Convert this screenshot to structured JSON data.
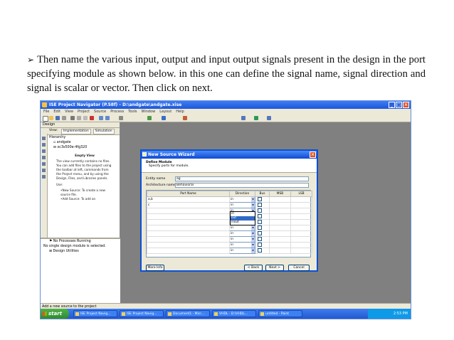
{
  "caption": {
    "bullet": "➢",
    "text": "Then name the various input, output and input output signals present in the design in the port specifying module as shown below. in this one can define the signal name, signal direction and signal is scalar or vector. Then click on next."
  },
  "window": {
    "title": "ISE Project Navigator (P.58f) - D:\\andgate\\andgate.xise",
    "menu": [
      "File",
      "Edit",
      "View",
      "Project",
      "Source",
      "Process",
      "Tools",
      "Window",
      "Layout",
      "Help"
    ]
  },
  "left_panel": {
    "header": "Design",
    "view_label": "View:",
    "tabs": [
      "Implementation",
      "Simulation"
    ],
    "hierarchy_label": "Hierarchy",
    "project": "andgate",
    "device": "xc3s500e-4fg320",
    "empty_view": {
      "title": "Empty View",
      "text": "The view currently contains no files. You can add files to the project using the toolbar at left, commands from the Project menu, and by using the Design, Files, and Libraries panels.",
      "use_label": "Use:",
      "items": [
        "•New Source: To create a new source file.",
        "•Add Source: To add an"
      ]
    },
    "processes": {
      "running": "No Processes Running",
      "message": "No single design module is selected.",
      "utilities": "Design Utilities"
    }
  },
  "wizard": {
    "title": "New Source Wizard",
    "heading": "Define Module",
    "subheading": "Specify ports for module.",
    "entity_label": "Entity name",
    "entity_value": "ag",
    "arch_label": "Architecture name",
    "arch_value": "Behavioral",
    "columns": [
      "Port Name",
      "Direction",
      "Bus",
      "MSB",
      "LSB"
    ],
    "rows": [
      {
        "name": "a,b",
        "direction": "in"
      },
      {
        "name": "c",
        "direction": "in"
      },
      {
        "name": "",
        "direction": "in"
      },
      {
        "name": "",
        "direction": "in"
      },
      {
        "name": "",
        "direction": "in"
      },
      {
        "name": "",
        "direction": "in"
      },
      {
        "name": "",
        "direction": "in"
      },
      {
        "name": "",
        "direction": "in"
      },
      {
        "name": "",
        "direction": "in"
      },
      {
        "name": "",
        "direction": "in"
      }
    ],
    "dropdown_options": [
      "in",
      "out",
      "inout"
    ],
    "dropdown_selected": "out",
    "buttons": {
      "more_info": "More Info",
      "back": "< Back",
      "next": "Next >",
      "cancel": "Cancel"
    }
  },
  "status_text": "Add a new source to the project",
  "taskbar": {
    "start": "start",
    "tasks": [
      "ISE Project Navig...",
      "ISE Project Navig...",
      "Document1 - Micr...",
      "VHDL - D:\\VHDL...",
      "untitled - Paint"
    ],
    "clock": "2:53 PM"
  }
}
